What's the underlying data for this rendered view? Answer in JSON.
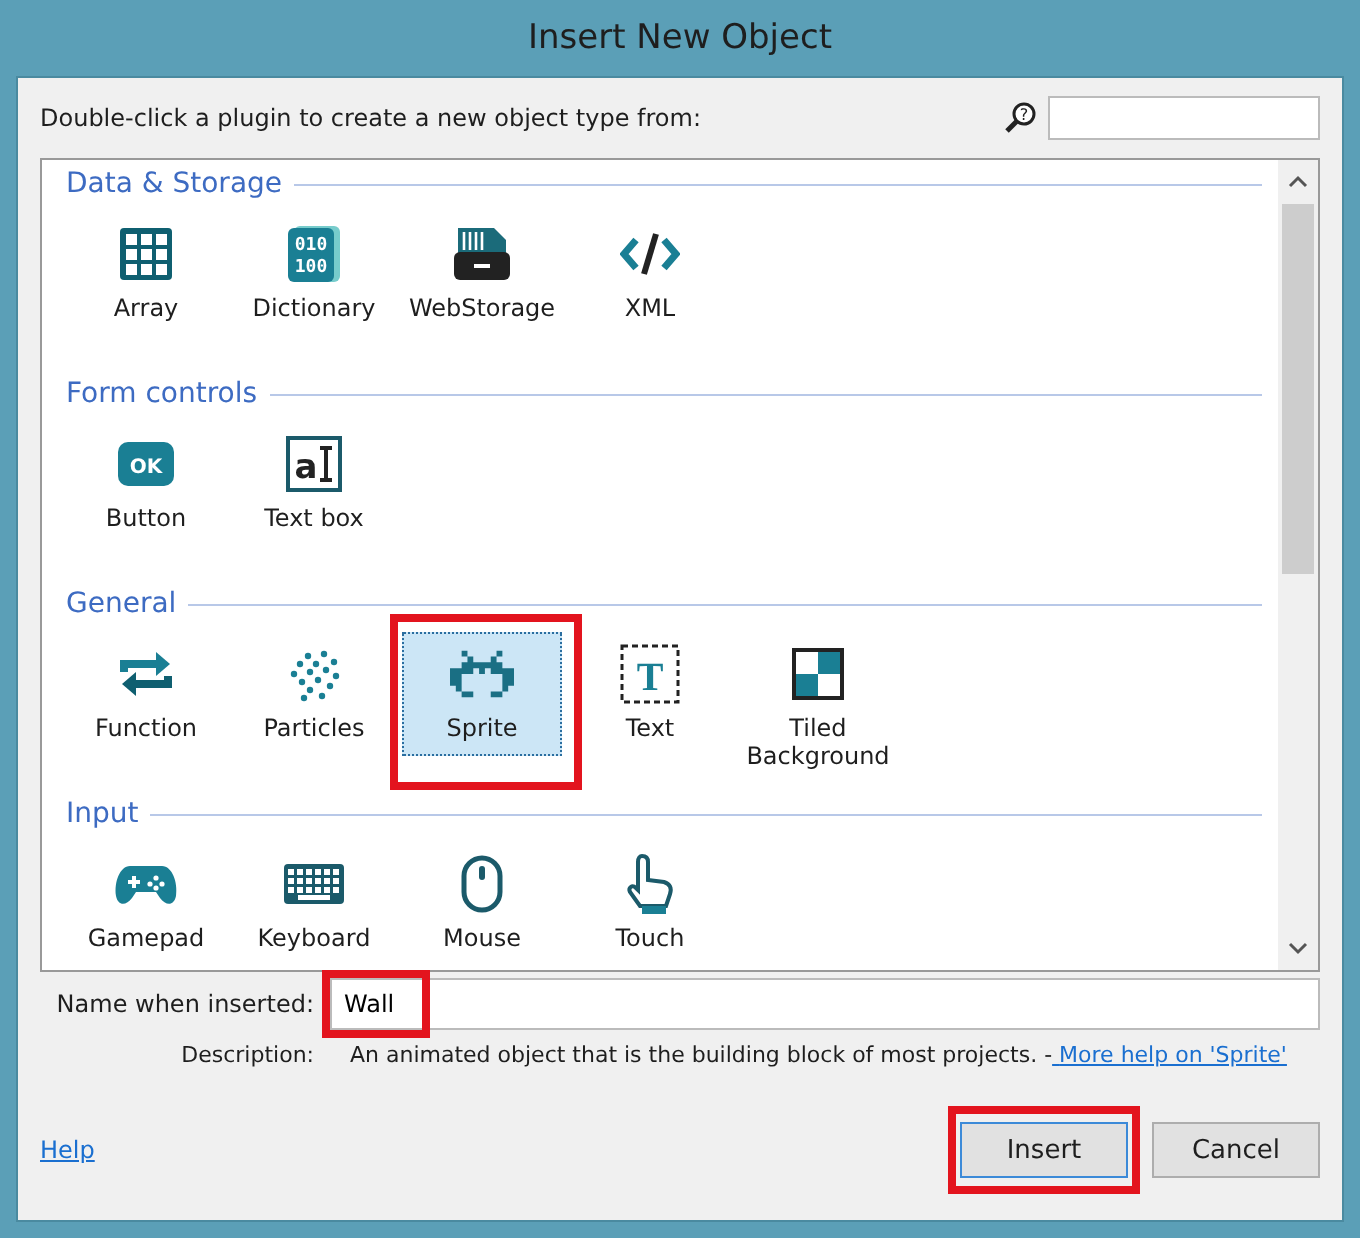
{
  "window": {
    "title": "Insert New Object"
  },
  "instruction": "Double-click a plugin to create a new object type from:",
  "search": {
    "icon_glyph": "?"
  },
  "sections": [
    {
      "title": "Data & Storage",
      "items": [
        {
          "label": "Array",
          "kind": "array",
          "selected": false,
          "highlighted": false
        },
        {
          "label": "Dictionary",
          "kind": "dictionary",
          "glyph": [
            "010",
            "100"
          ],
          "selected": false,
          "highlighted": false
        },
        {
          "label": "WebStorage",
          "kind": "webstorage",
          "selected": false,
          "highlighted": false
        },
        {
          "label": "XML",
          "kind": "xml",
          "selected": false,
          "highlighted": false
        }
      ]
    },
    {
      "title": "Form controls",
      "items": [
        {
          "label": "Button",
          "kind": "button",
          "glyph": [
            "OK"
          ],
          "selected": false,
          "highlighted": false
        },
        {
          "label": "Text box",
          "kind": "textbox",
          "glyph": [
            "a"
          ],
          "selected": false,
          "highlighted": false
        }
      ]
    },
    {
      "title": "General",
      "items": [
        {
          "label": "Function",
          "kind": "function",
          "selected": false,
          "highlighted": false
        },
        {
          "label": "Particles",
          "kind": "particles",
          "selected": false,
          "highlighted": false
        },
        {
          "label": "Sprite",
          "kind": "sprite",
          "selected": true,
          "highlighted": true
        },
        {
          "label": "Text",
          "kind": "text",
          "glyph": [
            "T"
          ],
          "selected": false,
          "highlighted": false
        },
        {
          "label": "Tiled Background",
          "kind": "tiled",
          "selected": false,
          "highlighted": false
        }
      ]
    },
    {
      "title": "Input",
      "items": [
        {
          "label": "Gamepad",
          "kind": "gamepad",
          "selected": false,
          "highlighted": false
        },
        {
          "label": "Keyboard",
          "kind": "keyboard",
          "selected": false,
          "highlighted": false
        },
        {
          "label": "Mouse",
          "kind": "mouse",
          "selected": false,
          "highlighted": false
        },
        {
          "label": "Touch",
          "kind": "touch",
          "selected": false,
          "highlighted": false
        }
      ]
    }
  ],
  "name_field": {
    "label": "Name when inserted:",
    "value": "Wall",
    "highlighted": true
  },
  "description": {
    "label": "Description:",
    "text": "An animated object that is the building block of most projects. -",
    "link": "More help on 'Sprite'"
  },
  "help_link": "Help",
  "buttons": [
    {
      "label": "Insert",
      "highlighted": true,
      "default": true
    },
    {
      "label": "Cancel",
      "highlighted": false,
      "default": false
    }
  ]
}
